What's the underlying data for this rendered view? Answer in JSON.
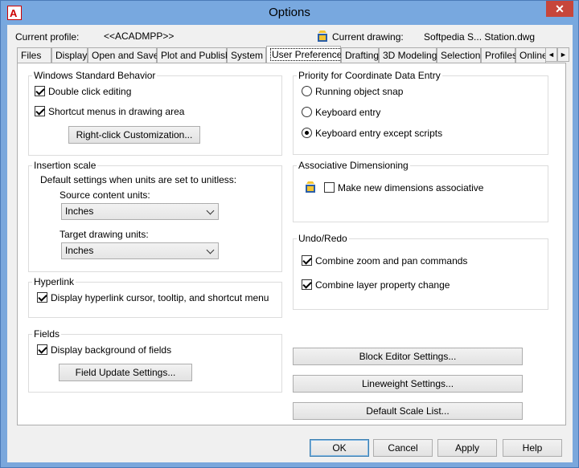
{
  "window": {
    "title": "Options",
    "close_glyph": "✕",
    "app_icon": "autocad-icon",
    "app_icon_letter": "A"
  },
  "profile": {
    "current_profile_label": "Current profile:",
    "current_profile_value": "<<ACADMPP>>",
    "current_drawing_label": "Current drawing:",
    "current_drawing_value": "Softpedia S... Station.dwg",
    "drawing_icon": "drawing-file-icon"
  },
  "tabs": [
    {
      "label": "Files"
    },
    {
      "label": "Display"
    },
    {
      "label": "Open and Save"
    },
    {
      "label": "Plot and Publish"
    },
    {
      "label": "System"
    },
    {
      "label": "User Preferences",
      "active": true
    },
    {
      "label": "Drafting"
    },
    {
      "label": "3D Modeling"
    },
    {
      "label": "Selection"
    },
    {
      "label": "Profiles"
    },
    {
      "label": "Online"
    }
  ],
  "tab_scroll": {
    "left": "◄",
    "right": "►"
  },
  "windows_behavior": {
    "title": "Windows Standard Behavior",
    "double_click": {
      "label": "Double click editing",
      "checked": true
    },
    "shortcut_menus": {
      "label": "Shortcut menus in drawing area",
      "checked": true
    },
    "right_click_button": "Right-click Customization..."
  },
  "insertion_scale": {
    "title": "Insertion scale",
    "description": "Default settings when units are set to unitless:",
    "source_label": "Source content units:",
    "source_value": "Inches",
    "target_label": "Target drawing units:",
    "target_value": "Inches"
  },
  "hyperlink": {
    "title": "Hyperlink",
    "display": {
      "label": "Display hyperlink cursor, tooltip, and shortcut menu",
      "checked": true
    }
  },
  "fields": {
    "title": "Fields",
    "display_background": {
      "label": "Display background of fields",
      "checked": true
    },
    "update_button": "Field Update Settings..."
  },
  "priority": {
    "title": "Priority for Coordinate Data Entry",
    "options": [
      {
        "label": "Running object snap",
        "checked": false
      },
      {
        "label": "Keyboard entry",
        "checked": false
      },
      {
        "label": "Keyboard entry except scripts",
        "checked": true
      }
    ]
  },
  "assoc_dim": {
    "title": "Associative Dimensioning",
    "make_new": {
      "label": "Make new dimensions associative",
      "checked": false
    },
    "icon": "drawing-file-icon"
  },
  "undo_redo": {
    "title": "Undo/Redo",
    "combine_zoom": {
      "label": "Combine zoom and pan commands",
      "checked": true
    },
    "combine_layer": {
      "label": "Combine layer property change",
      "checked": true
    }
  },
  "right_buttons": {
    "block_editor": "Block Editor Settings...",
    "lineweight": "Lineweight Settings...",
    "default_scale": "Default Scale List..."
  },
  "footer": {
    "ok": "OK",
    "cancel": "Cancel",
    "apply": "Apply",
    "help": "Help"
  },
  "colors": {
    "title_bar": "#78a8df",
    "close_button": "#c7463b",
    "dialog_bg": "#f0f0f0",
    "panel_bg": "#ffffff"
  }
}
